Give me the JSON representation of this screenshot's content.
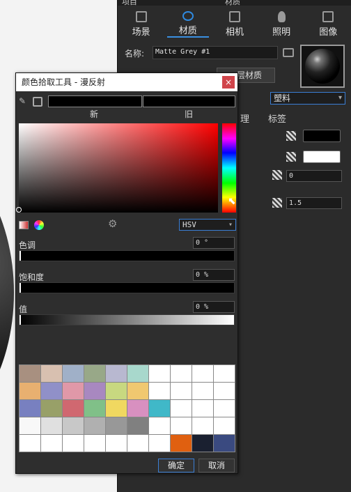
{
  "panel": {
    "top_left": "项目",
    "top_title": "材质",
    "tabs": [
      {
        "label": "场景"
      },
      {
        "label": "材质"
      },
      {
        "label": "相机"
      },
      {
        "label": "照明"
      },
      {
        "label": "图像"
      }
    ],
    "name_label": "名称:",
    "name_value": "Matte Grey #1",
    "multilayer_label": "层材质",
    "type_value": "塑料",
    "subtab_texture_partial": "理",
    "subtab_labels": "标签",
    "field_value_1": "0",
    "field_value_2": "1.5"
  },
  "dialog": {
    "title": "颜色拾取工具 - 漫反射",
    "close_glyph": "×",
    "new_label": "新",
    "old_label": "旧",
    "new_color": "#000000",
    "old_color": "#000000",
    "mode": "HSV",
    "hue": {
      "label": "色调",
      "value": "0 °"
    },
    "saturation": {
      "label": "饱和度",
      "value": "0 %"
    },
    "brightness": {
      "label": "值",
      "value": "0 %"
    },
    "palette": [
      "#a89080",
      "#d8c0b0",
      "#a0b0c8",
      "#98a888",
      "#b8b8d0",
      "#a8d8cc",
      "#ffffff",
      "#ffffff",
      "#ffffff",
      "#ffffff",
      "#e8b070",
      "#9090c8",
      "#e098a8",
      "#a888c0",
      "#c8d880",
      "#f0c870",
      "#ffffff",
      "#ffffff",
      "#ffffff",
      "#ffffff",
      "#7880c0",
      "#98a068",
      "#d06870",
      "#80c088",
      "#f0d860",
      "#d890c0",
      "#40b8c8",
      "#ffffff",
      "#ffffff",
      "#ffffff",
      "#f8f8f8",
      "#e0e0e0",
      "#c8c8c8",
      "#b0b0b0",
      "#989898",
      "#808080",
      "#ffffff",
      "#ffffff",
      "#ffffff",
      "#ffffff",
      "#ffffff",
      "#ffffff",
      "#ffffff",
      "#ffffff",
      "#ffffff",
      "#ffffff",
      "#ffffff",
      "#e06010",
      "#1a2030",
      "#3a4a80"
    ],
    "ok_label": "确定",
    "cancel_label": "取消"
  }
}
